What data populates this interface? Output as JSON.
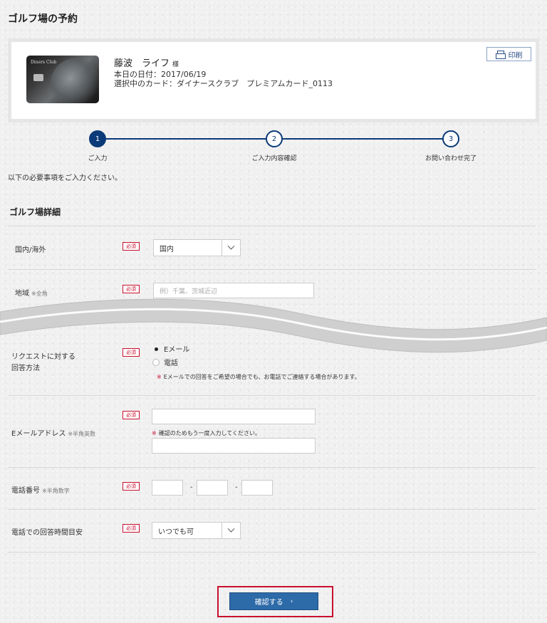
{
  "page": {
    "title": "ゴルフ場の予約"
  },
  "member": {
    "name": "藤波　ライフ",
    "honorific": "様",
    "date_line": "本日の日付：2017/06/19",
    "card_line": "選択中のカード：ダイナースクラブ　プレミアムカード_0113",
    "print_label": "印刷"
  },
  "steps": [
    {
      "number": "1",
      "label": "ご入力",
      "active": true
    },
    {
      "number": "2",
      "label": "ご入力内容確認",
      "active": false
    },
    {
      "number": "3",
      "label": "お問い合わせ完了",
      "active": false
    }
  ],
  "intro": "以下の必要事項をご入力ください。",
  "section": {
    "title": "ゴルフ場詳細"
  },
  "required_label": "必須",
  "form": {
    "domestic": {
      "label": "国内/海外",
      "value": "国内"
    },
    "region": {
      "label": "地域",
      "note": "※全角",
      "placeholder": "例）千葉、茨城近辺"
    },
    "reply_method": {
      "label_line1": "リクエストに対する",
      "label_line2": "回答方法",
      "options": [
        {
          "label": "Eメール",
          "checked": true
        },
        {
          "label": "電話",
          "checked": false
        }
      ],
      "notice": "Eメールでの回答をご希望の場合でも、お電話でご連絡する場合があります。"
    },
    "email": {
      "label": "Eメールアドレス",
      "note": "※半角英数",
      "confirm_notice": "確認のためもう一度入力してください。"
    },
    "phone": {
      "label": "電話番号",
      "note": "※半角数字",
      "separator": "-"
    },
    "reply_time": {
      "label": "電話での回答時間目安",
      "value": "いつでも可"
    }
  },
  "notice_mark": "※",
  "confirm": {
    "label": "確認する",
    "chevron": "›"
  },
  "colors": {
    "accent": "#0b3a78",
    "required": "#c8102e",
    "confirm": "#2d6aa8"
  }
}
